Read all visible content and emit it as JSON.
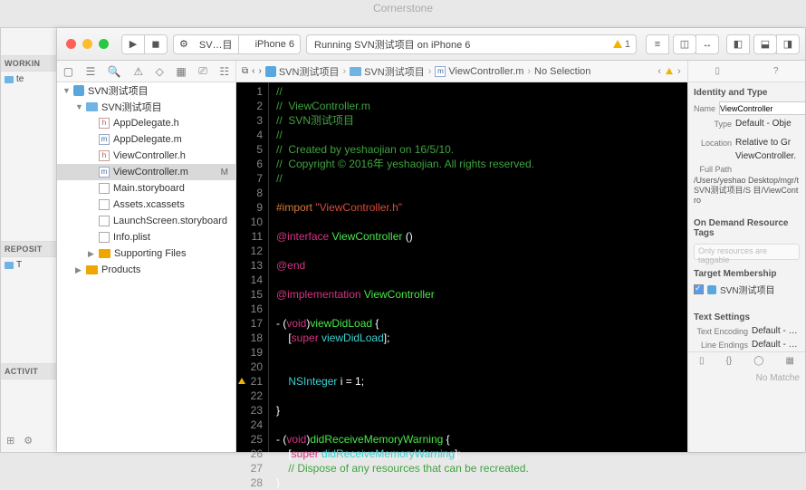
{
  "background_app": "Cornerstone",
  "left_strip": {
    "sections": [
      "WORKIN",
      "REPOSIT",
      "ACTIVIT"
    ],
    "working_item": "te",
    "repo_item": "T"
  },
  "toolbar": {
    "scheme_target": "SV…目",
    "scheme_device": "iPhone 6",
    "status_text": "Running SVN测试项目 on iPhone 6",
    "warn_count": "1"
  },
  "navigator": {
    "root": "SVN测试项目",
    "group": "SVN测试项目",
    "files": [
      {
        "name": "AppDelegate.h",
        "kind": "h"
      },
      {
        "name": "AppDelegate.m",
        "kind": "m"
      },
      {
        "name": "ViewController.h",
        "kind": "h"
      },
      {
        "name": "ViewController.m",
        "kind": "m",
        "selected": true,
        "badge": "M"
      },
      {
        "name": "Main.storyboard",
        "kind": "sb"
      },
      {
        "name": "Assets.xcassets",
        "kind": "xc"
      },
      {
        "name": "LaunchScreen.storyboard",
        "kind": "sb"
      },
      {
        "name": "Info.plist",
        "kind": "plist"
      }
    ],
    "support": "Supporting Files",
    "products": "Products"
  },
  "jump_bar": {
    "segments": [
      "SVN测试项目",
      "SVN测试项目",
      "ViewController.m",
      "No Selection"
    ]
  },
  "code": {
    "lines": [
      {
        "n": 1,
        "t": "comment",
        "text": "//"
      },
      {
        "n": 2,
        "t": "comment",
        "text": "//  ViewController.m"
      },
      {
        "n": 3,
        "t": "comment",
        "text": "//  SVN测试项目"
      },
      {
        "n": 4,
        "t": "comment",
        "text": "//"
      },
      {
        "n": 5,
        "t": "comment",
        "text": "//  Created by yeshaojian on 16/5/10."
      },
      {
        "n": 6,
        "t": "comment",
        "text": "//  Copyright © 2016年 yeshaojian. All rights reserved."
      },
      {
        "n": 7,
        "t": "comment",
        "text": "//"
      },
      {
        "n": 8,
        "t": "blank",
        "text": ""
      },
      {
        "n": 9,
        "t": "import",
        "pre": "#import ",
        "str": "\"ViewController.h\""
      },
      {
        "n": 10,
        "t": "blank",
        "text": ""
      },
      {
        "n": 11,
        "t": "iface",
        "kw": "@interface ",
        "cls": "ViewController",
        "rest": " ()"
      },
      {
        "n": 12,
        "t": "blank",
        "text": ""
      },
      {
        "n": 13,
        "t": "kw",
        "text": "@end"
      },
      {
        "n": 14,
        "t": "blank",
        "text": ""
      },
      {
        "n": 15,
        "t": "impl",
        "kw": "@implementation ",
        "cls": "ViewController"
      },
      {
        "n": 16,
        "t": "blank",
        "text": ""
      },
      {
        "n": 17,
        "t": "mdecl",
        "pre": "- (",
        "type": "void",
        "post": ")",
        "name": "viewDidLoad",
        "tail": " {"
      },
      {
        "n": 18,
        "t": "scall",
        "indent": "    [",
        "sup": "super",
        "sp": " ",
        "msg": "viewDidLoad",
        "tail": "];"
      },
      {
        "n": 19,
        "t": "blank",
        "text": ""
      },
      {
        "n": 20,
        "t": "blank",
        "text": ""
      },
      {
        "n": 21,
        "t": "decl",
        "indent": "    ",
        "type": "NSInteger",
        "rest": " i = 1;",
        "warn": true
      },
      {
        "n": 22,
        "t": "blank",
        "text": "    "
      },
      {
        "n": 23,
        "t": "plain",
        "text": "}"
      },
      {
        "n": 24,
        "t": "blank",
        "text": ""
      },
      {
        "n": 25,
        "t": "mdecl",
        "pre": "- (",
        "type": "void",
        "post": ")",
        "name": "didReceiveMemoryWarning",
        "tail": " {"
      },
      {
        "n": 26,
        "t": "scall",
        "indent": "    [",
        "sup": "super",
        "sp": " ",
        "msg": "didReceiveMemoryWarning",
        "tail": "];"
      },
      {
        "n": 27,
        "t": "comment",
        "text": "    // Dispose of any resources that can be recreated."
      },
      {
        "n": 28,
        "t": "plain",
        "text": "}"
      }
    ]
  },
  "inspector": {
    "identity_title": "Identity and Type",
    "name_label": "Name",
    "name_value": "ViewController",
    "type_label": "Type",
    "type_value": "Default - Obje",
    "location_label": "Location",
    "location_value": "Relative to Gr",
    "location_file": "ViewController.",
    "fullpath_label": "Full Path",
    "fullpath_value": "/Users/yeshao Desktop/mgr/t SVN测试项目/S 目/ViewContro",
    "tags_title": "On Demand Resource Tags",
    "tags_placeholder": "Only resources are taggable",
    "target_title": "Target Membership",
    "target_name": "SVN测试项目",
    "text_title": "Text Settings",
    "enc_label": "Text Encoding",
    "enc_value": "Default - Unic",
    "le_label": "Line Endings",
    "le_value": "Default - OS X",
    "nomatch": "No Matche"
  }
}
